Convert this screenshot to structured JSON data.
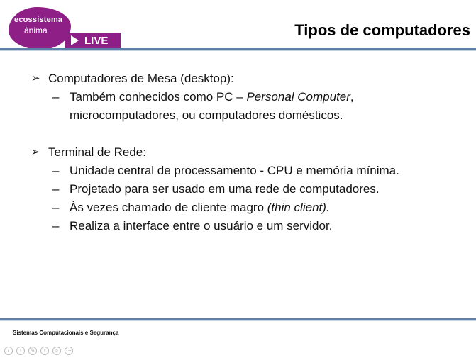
{
  "header": {
    "logo_line1": "ecossistema",
    "logo_line2": "ânima",
    "live_label": "LIVE",
    "title": "Tipos de computadores"
  },
  "content": {
    "bullet1": "Computadores de Mesa (desktop):",
    "bullet1_sub1_pre": "Também conhecidos como PC – ",
    "bullet1_sub1_em": "Personal Computer",
    "bullet1_sub1_post": ",",
    "bullet1_sub1_line2": "microcomputadores, ou computadores domésticos.",
    "bullet2": "Terminal de Rede:",
    "bullet2_sub1": "Unidade central de processamento - CPU e memória mínima.",
    "bullet2_sub2": "Projetado para ser usado em uma rede de computadores.",
    "bullet2_sub3_pre": "Às vezes chamado de cliente magro ",
    "bullet2_sub3_em": "(thin client).",
    "bullet2_sub4": "Realiza a interface entre o usuário e um servidor."
  },
  "footer": {
    "text": "Sistemas Computacionais e Segurança"
  },
  "controls": [
    "previous-slide",
    "next-slide",
    "pen-tool",
    "slides-overview",
    "zoom",
    "more-options"
  ],
  "colors": {
    "brand_purple": "#8e1f86",
    "rule_blue": "#5e7fa7"
  }
}
